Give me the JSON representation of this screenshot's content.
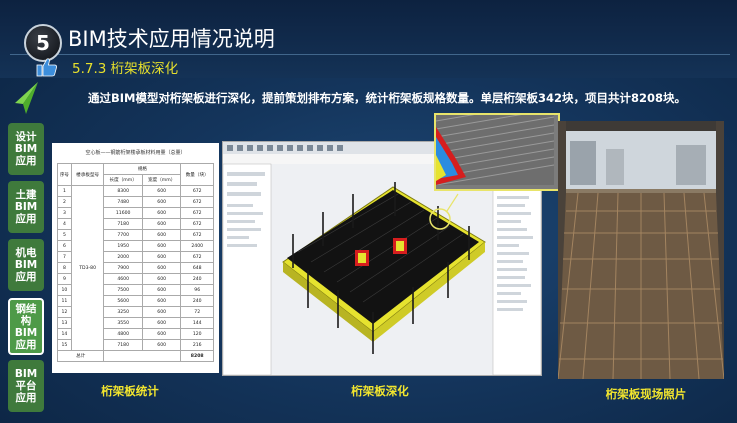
{
  "section_number": "5",
  "title": "BIM技术应用情况说明",
  "subtitle": "5.7.3 桁架板深化",
  "description": "通过BIM模型对桁架板进行深化，提前策划排布方案，统计桁架板规格数量。单层桁架板342块，项目共计8208块。",
  "nav": [
    {
      "label": "设计\nBIM\n应用",
      "active": false
    },
    {
      "label": "土建\nBIM\n应用",
      "active": false
    },
    {
      "label": "机电\nBIM\n应用",
      "active": false
    },
    {
      "label": "钢结\n构\nBIM\n应用",
      "active": true
    },
    {
      "label": "BIM\n平台\n应用",
      "active": false
    }
  ],
  "table": {
    "title": "空心板——钢筋桁架楼承板材料用量（总量）",
    "headers": [
      "序号",
      "楼承板型号",
      "规格",
      "",
      "数量（块）"
    ],
    "subheaders": [
      "长度（mm）",
      "宽度（mm）"
    ],
    "model": "TD3-80",
    "rows": [
      [
        "1",
        "8300",
        "600",
        "672"
      ],
      [
        "2",
        "7480",
        "600",
        "672"
      ],
      [
        "3",
        "11600",
        "600",
        "672"
      ],
      [
        "4",
        "7180",
        "600",
        "672"
      ],
      [
        "5",
        "7700",
        "600",
        "672"
      ],
      [
        "6",
        "1950",
        "600",
        "2400"
      ],
      [
        "7",
        "2000",
        "600",
        "672"
      ],
      [
        "8",
        "7900",
        "600",
        "648"
      ],
      [
        "9",
        "4600",
        "600",
        "240"
      ],
      [
        "10",
        "7500",
        "600",
        "96"
      ],
      [
        "11",
        "5600",
        "600",
        "240"
      ],
      [
        "12",
        "3250",
        "600",
        "72"
      ],
      [
        "13",
        "3550",
        "600",
        "144"
      ],
      [
        "14",
        "4800",
        "600",
        "120"
      ],
      [
        "15",
        "7180",
        "600",
        "216"
      ]
    ],
    "total_label": "总计",
    "total_value": "8208"
  },
  "captions": {
    "stats": "桁架板统计",
    "deepening": "桁架板深化",
    "site_photo": "桁架板现场照片"
  }
}
